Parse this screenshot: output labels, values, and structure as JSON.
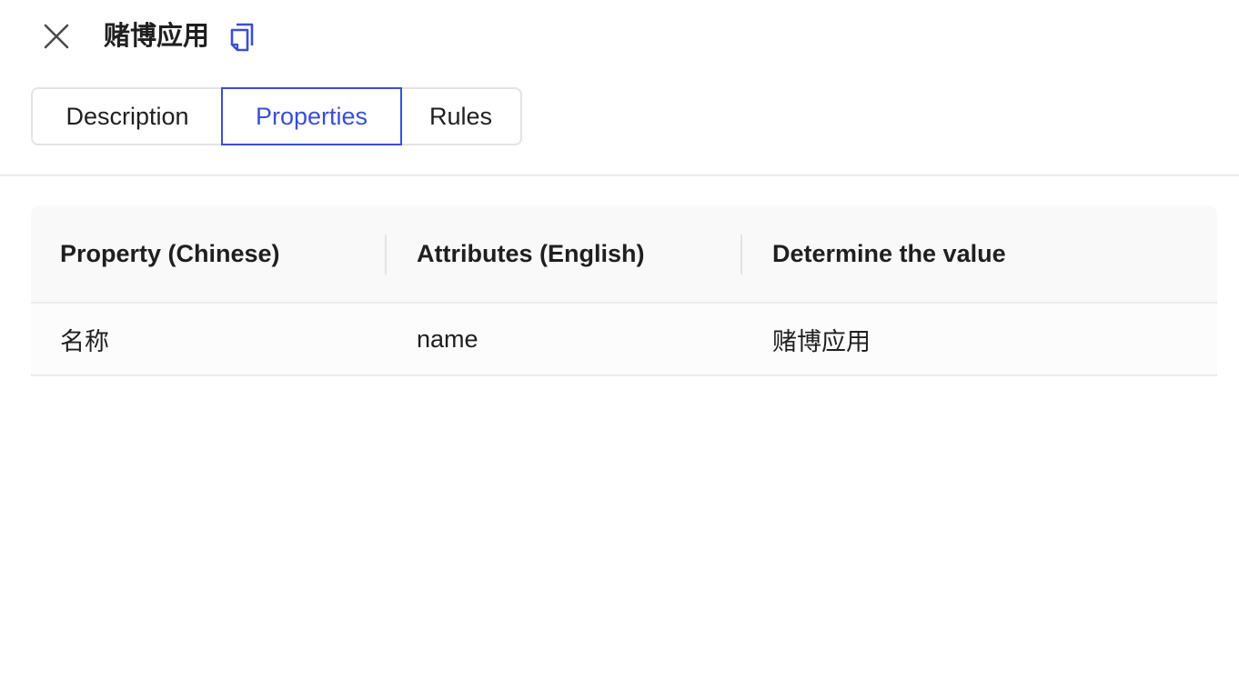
{
  "header": {
    "close_icon": "close-icon",
    "title": "赌博应用",
    "copy_icon": "copy-icon",
    "accent_color": "#3a4fd0"
  },
  "tabs": [
    {
      "label": "Description",
      "active": false
    },
    {
      "label": "Properties",
      "active": true
    },
    {
      "label": "Rules",
      "active": false
    }
  ],
  "table": {
    "columns": [
      "Property (Chinese)",
      "Attributes (English)",
      "Determine the value"
    ],
    "rows": [
      [
        "名称",
        "name",
        "赌博应用"
      ]
    ]
  }
}
